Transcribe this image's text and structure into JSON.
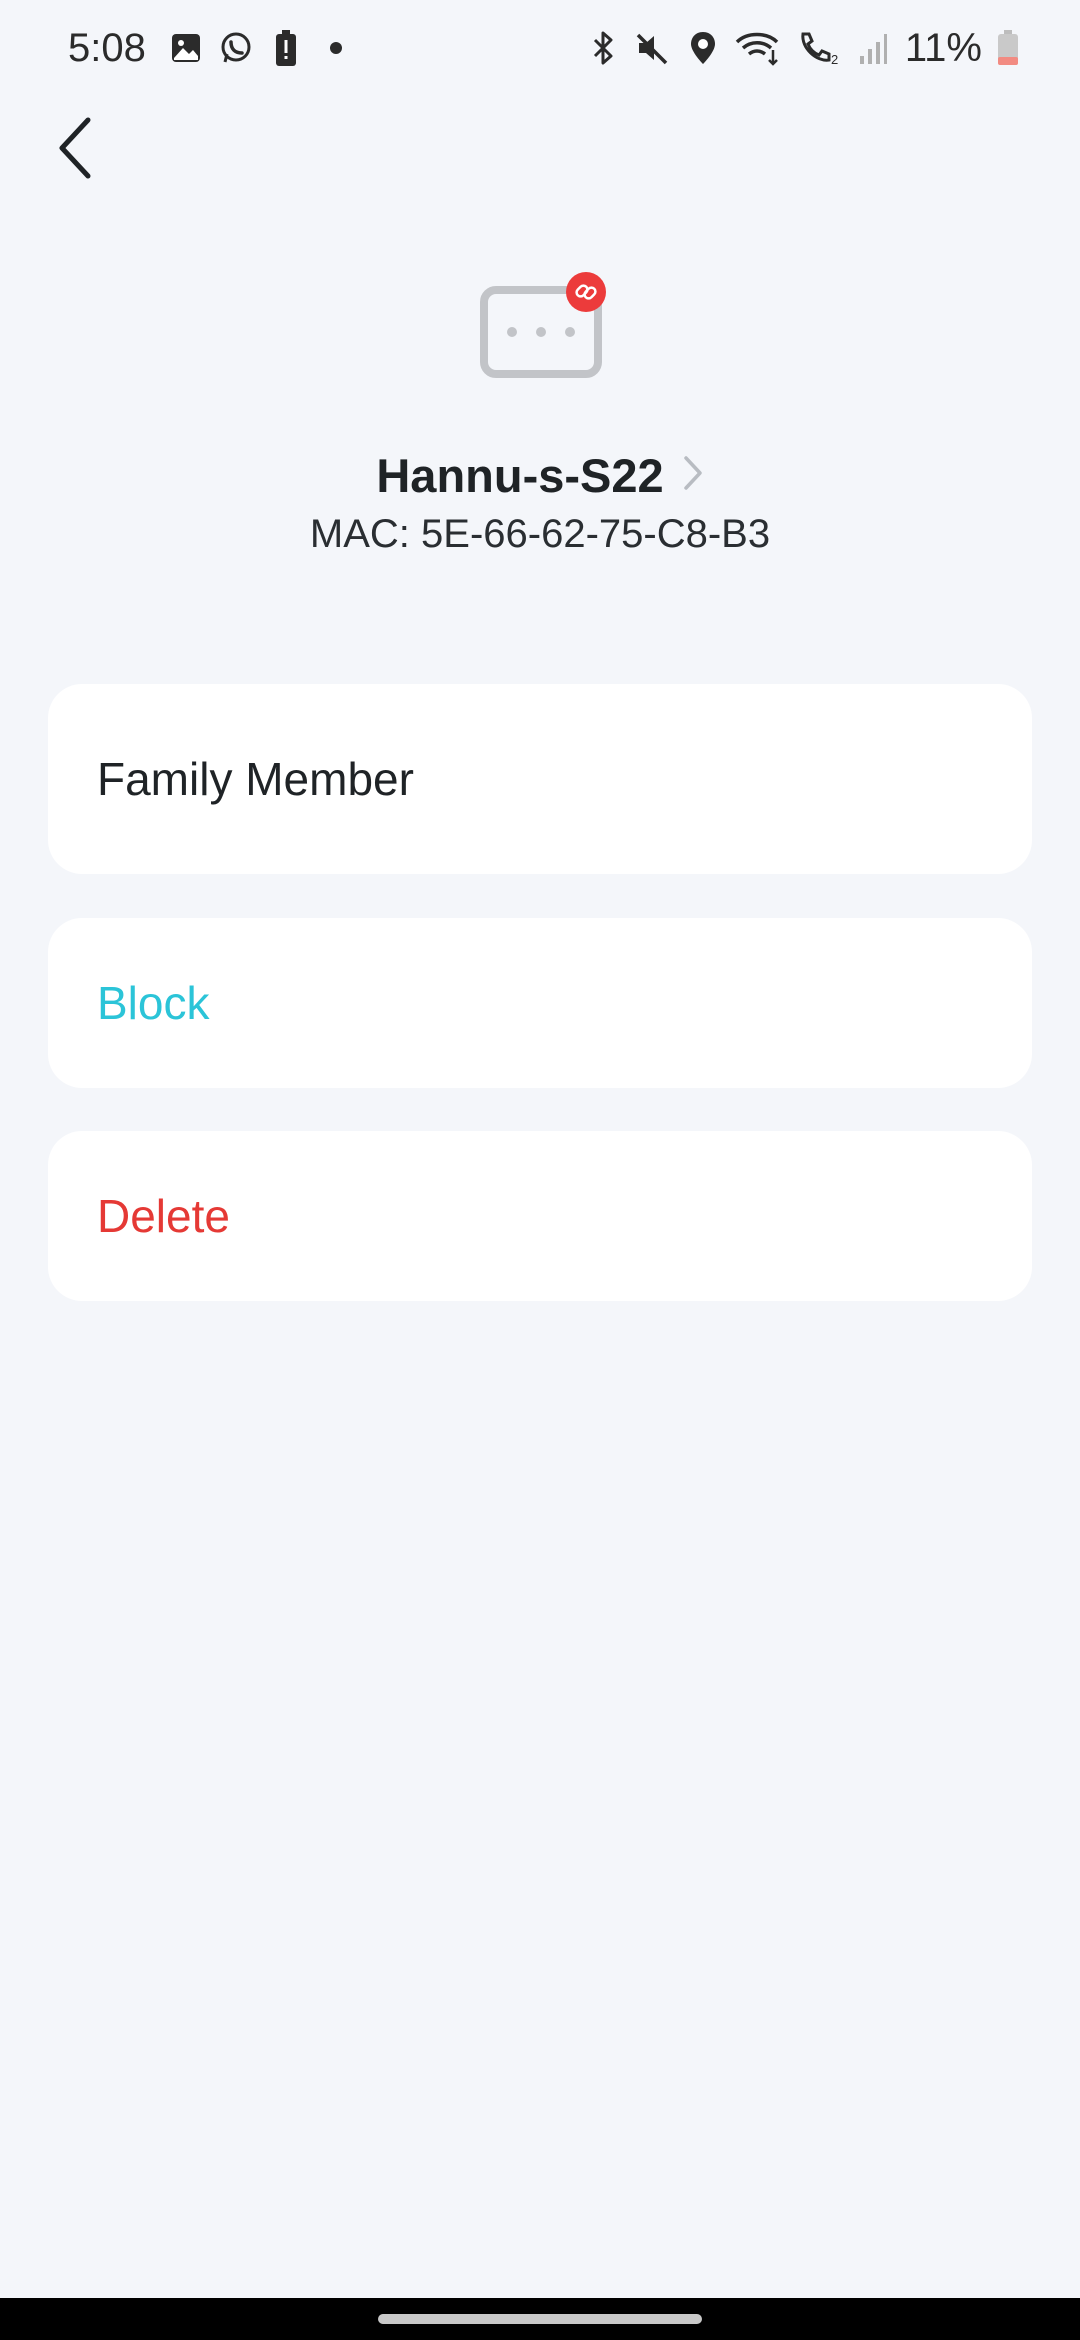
{
  "status_bar": {
    "time": "5:08",
    "battery_percent": "11%",
    "left_icons": [
      "image-icon",
      "whatsapp-icon",
      "battery-alert-icon",
      "dot-icon"
    ],
    "right_icons": [
      "bluetooth-icon",
      "mute-icon",
      "location-icon",
      "wifi-calling-icon",
      "call-icon",
      "signal-icon",
      "battery-icon"
    ]
  },
  "header": {
    "back_icon": "chevron-left-icon"
  },
  "device": {
    "icon": "device-generic-icon",
    "badge_icon": "unlink-badge-icon",
    "name": "Hannu-s-S22",
    "mac": "MAC: 5E-66-62-75-C8-B3",
    "chevron_icon": "chevron-right-icon"
  },
  "actions": {
    "family_member": "Family Member",
    "block": "Block",
    "delete": "Delete"
  },
  "colors": {
    "background": "#f4f6fa",
    "card": "#ffffff",
    "block": "#2bc4d8",
    "delete": "#e53935",
    "badge": "#ec3b3b",
    "device_icon": "#c2c4c8"
  }
}
